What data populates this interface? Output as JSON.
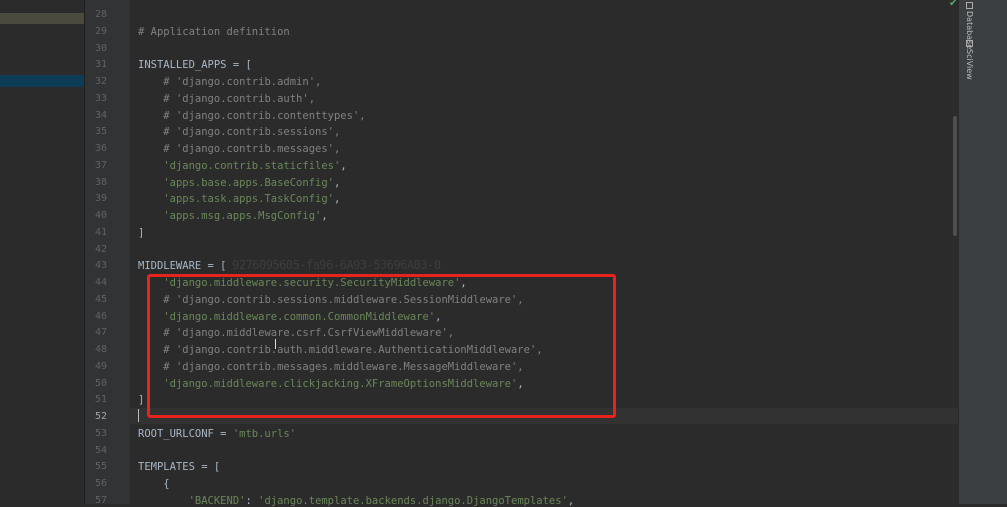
{
  "right_tool_window": {
    "database_label": "Database",
    "sciview_label": "SciView"
  },
  "overlay": {
    "text": "9276095605-fa96-6A93-53696A03-0"
  },
  "editor": {
    "current_line": 52,
    "lines": [
      {
        "n": 28,
        "html": ""
      },
      {
        "n": 29,
        "html": "<span class=\"c-com\"># Application definition</span>"
      },
      {
        "n": 30,
        "html": ""
      },
      {
        "n": 31,
        "html": "<span class=\"c-def\">INSTALLED_APPS = [</span>"
      },
      {
        "n": 32,
        "html": "    <span class=\"c-com\"># 'django.contrib.admin',</span>"
      },
      {
        "n": 33,
        "html": "    <span class=\"c-com\"># 'django.contrib.auth',</span>"
      },
      {
        "n": 34,
        "html": "    <span class=\"c-com\"># 'django.contrib.contenttypes',</span>"
      },
      {
        "n": 35,
        "html": "    <span class=\"c-com\"># 'django.contrib.sessions',</span>"
      },
      {
        "n": 36,
        "html": "    <span class=\"c-com\"># 'django.contrib.messages',</span>"
      },
      {
        "n": 37,
        "html": "    <span class=\"c-str\">'django.contrib.staticfiles'</span>,"
      },
      {
        "n": 38,
        "html": "    <span class=\"c-str\">'apps.base.apps.BaseConfig'</span>,"
      },
      {
        "n": 39,
        "html": "    <span class=\"c-str\">'apps.task.apps.TaskConfig'</span>,"
      },
      {
        "n": 40,
        "html": "    <span class=\"c-str\">'apps.msg.apps.MsgConfig'</span>,"
      },
      {
        "n": 41,
        "html": "]"
      },
      {
        "n": 42,
        "html": ""
      },
      {
        "n": 43,
        "html": "<span class=\"c-def\">MIDDLEWARE = [</span>"
      },
      {
        "n": 44,
        "html": "    <span class=\"c-str\">'django.middleware.security.SecurityMiddleware'</span>,"
      },
      {
        "n": 45,
        "html": "    <span class=\"c-com\"># 'django.contrib.sessions.middleware.SessionMiddleware',</span>"
      },
      {
        "n": 46,
        "html": "    <span class=\"c-str\">'django.middleware.common.CommonMiddleware'</span>,"
      },
      {
        "n": 47,
        "html": "    <span class=\"c-com\"># 'django.middleware.csrf.CsrfViewMiddleware',</span>"
      },
      {
        "n": 48,
        "html": "    <span class=\"c-com\"># 'django.contrib.auth.middleware.AuthenticationMiddleware',</span>"
      },
      {
        "n": 49,
        "html": "    <span class=\"c-com\"># 'django.contrib.messages.middleware.MessageMiddleware',</span>"
      },
      {
        "n": 50,
        "html": "    <span class=\"c-str\">'django.middleware.clickjacking.XFrameOptionsMiddleware'</span>,"
      },
      {
        "n": 51,
        "html": "]"
      },
      {
        "n": 52,
        "html": ""
      },
      {
        "n": 53,
        "html": "<span class=\"c-def\">ROOT_URLCONF = </span><span class=\"c-str\">'mtb.urls'</span>"
      },
      {
        "n": 54,
        "html": ""
      },
      {
        "n": 55,
        "html": "<span class=\"c-def\">TEMPLATES = [</span>"
      },
      {
        "n": 56,
        "html": "    {"
      },
      {
        "n": 57,
        "html": "        <span class=\"c-str\">'BACKEND'</span>: <span class=\"c-str\">'django.template.backends.django.DjangoTemplates'</span>,"
      }
    ]
  }
}
